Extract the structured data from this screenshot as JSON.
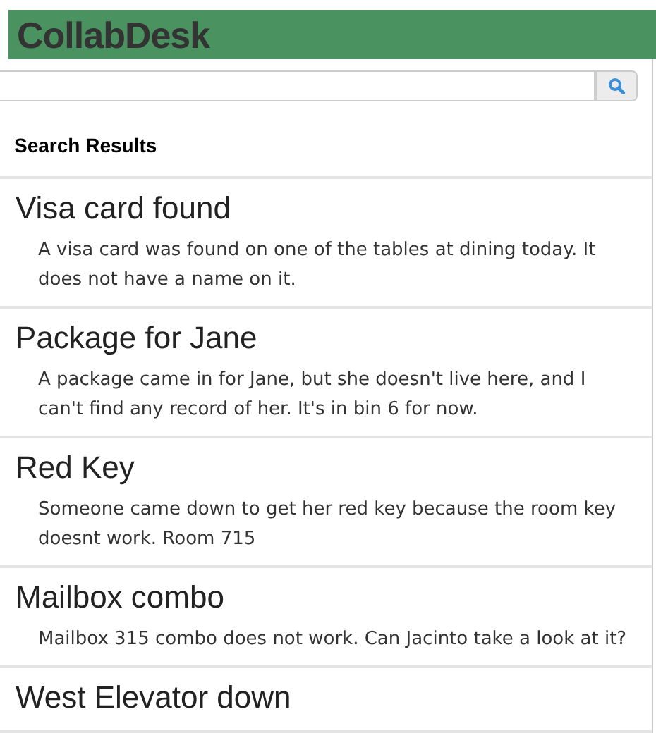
{
  "header": {
    "title": "CollabDesk"
  },
  "results_heading": "Search Results",
  "results": [
    {
      "title": "Visa card found",
      "description": "A visa card was found on one of the tables at dining today. It does not have a name on it."
    },
    {
      "title": "Package for Jane",
      "description": "A package came in for Jane, but she doesn't live here, and I can't find any record of her. It's in bin 6 for now."
    },
    {
      "title": "Red Key",
      "description": "Someone came down to get her red key because the room key doesnt work. Room 715"
    },
    {
      "title": "Mailbox combo",
      "description": "Mailbox 315 combo does not work. Can Jacinto take a look at it?"
    },
    {
      "title": "West Elevator down"
    }
  ]
}
